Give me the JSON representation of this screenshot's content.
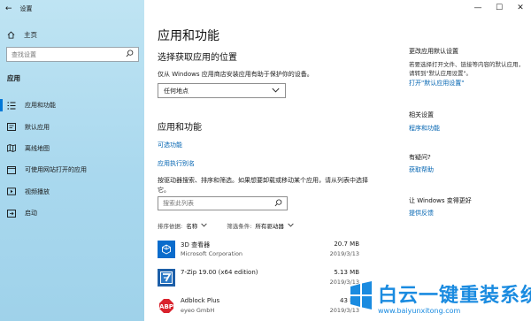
{
  "window": {
    "title": "设置"
  },
  "sidebar": {
    "home_label": "主页",
    "search_placeholder": "查找设置",
    "section_label": "应用",
    "items": [
      {
        "label": "应用和功能",
        "icon": "apps-list-icon",
        "active": true
      },
      {
        "label": "默认应用",
        "icon": "default-apps-icon"
      },
      {
        "label": "离线地图",
        "icon": "offline-map-icon"
      },
      {
        "label": "可使用网站打开的应用",
        "icon": "web-apps-icon"
      },
      {
        "label": "视频播放",
        "icon": "video-playback-icon"
      },
      {
        "label": "启动",
        "icon": "startup-icon"
      }
    ]
  },
  "main": {
    "title": "应用和功能",
    "install_heading": "选择获取应用的位置",
    "install_desc": "仅从 Windows 应用商店安装应用有助于保护你的设备。",
    "install_select_value": "任何地点",
    "apps_heading": "应用和功能",
    "optional_features_link": "可选功能",
    "app_aliases_link": "应用执行别名",
    "search_desc": "按驱动器搜索、排序和筛选。如果想要卸载或移动某个应用，请从列表中选择它。",
    "search_placeholder": "搜索此列表",
    "sort_label": "排序依据:",
    "sort_value": "名称",
    "filter_label": "筛选条件:",
    "filter_value": "所有驱动器",
    "apps": [
      {
        "name": "3D 查看器",
        "publisher": "Microsoft Corporation",
        "size": "20.7 MB",
        "date": "2019/3/13",
        "icon": "3d-viewer-icon"
      },
      {
        "name": "7-Zip 19.00 (x64 edition)",
        "publisher": "",
        "size": "5.13 MB",
        "date": "2019/3/13",
        "icon": "7zip-icon"
      },
      {
        "name": "Adblock Plus",
        "publisher": "eyeo GmbH",
        "size": "43 MB",
        "date": "2019/3/13",
        "icon": "adblock-icon"
      }
    ]
  },
  "right_panel": {
    "default_heading": "更改应用默认设置",
    "default_desc": "若要选择打开文件、链接等内容的默认应用，请转到\"默认应用设置\"。",
    "default_link": "打开\"默认应用设置\"",
    "related_heading": "相关设置",
    "related_link": "程序和功能",
    "question_heading": "有疑问?",
    "help_link": "获取帮助",
    "improve_heading": "让 Windows 变得更好",
    "feedback_link": "提供反馈"
  },
  "watermark": {
    "text": "白云一键重装系统",
    "url": "www.baiyunxitong.com"
  },
  "colors": {
    "accent": "#0078d7",
    "link": "#0063b1",
    "sidebar_bg": "#abd9ee",
    "watermark": "#1a8be0"
  }
}
